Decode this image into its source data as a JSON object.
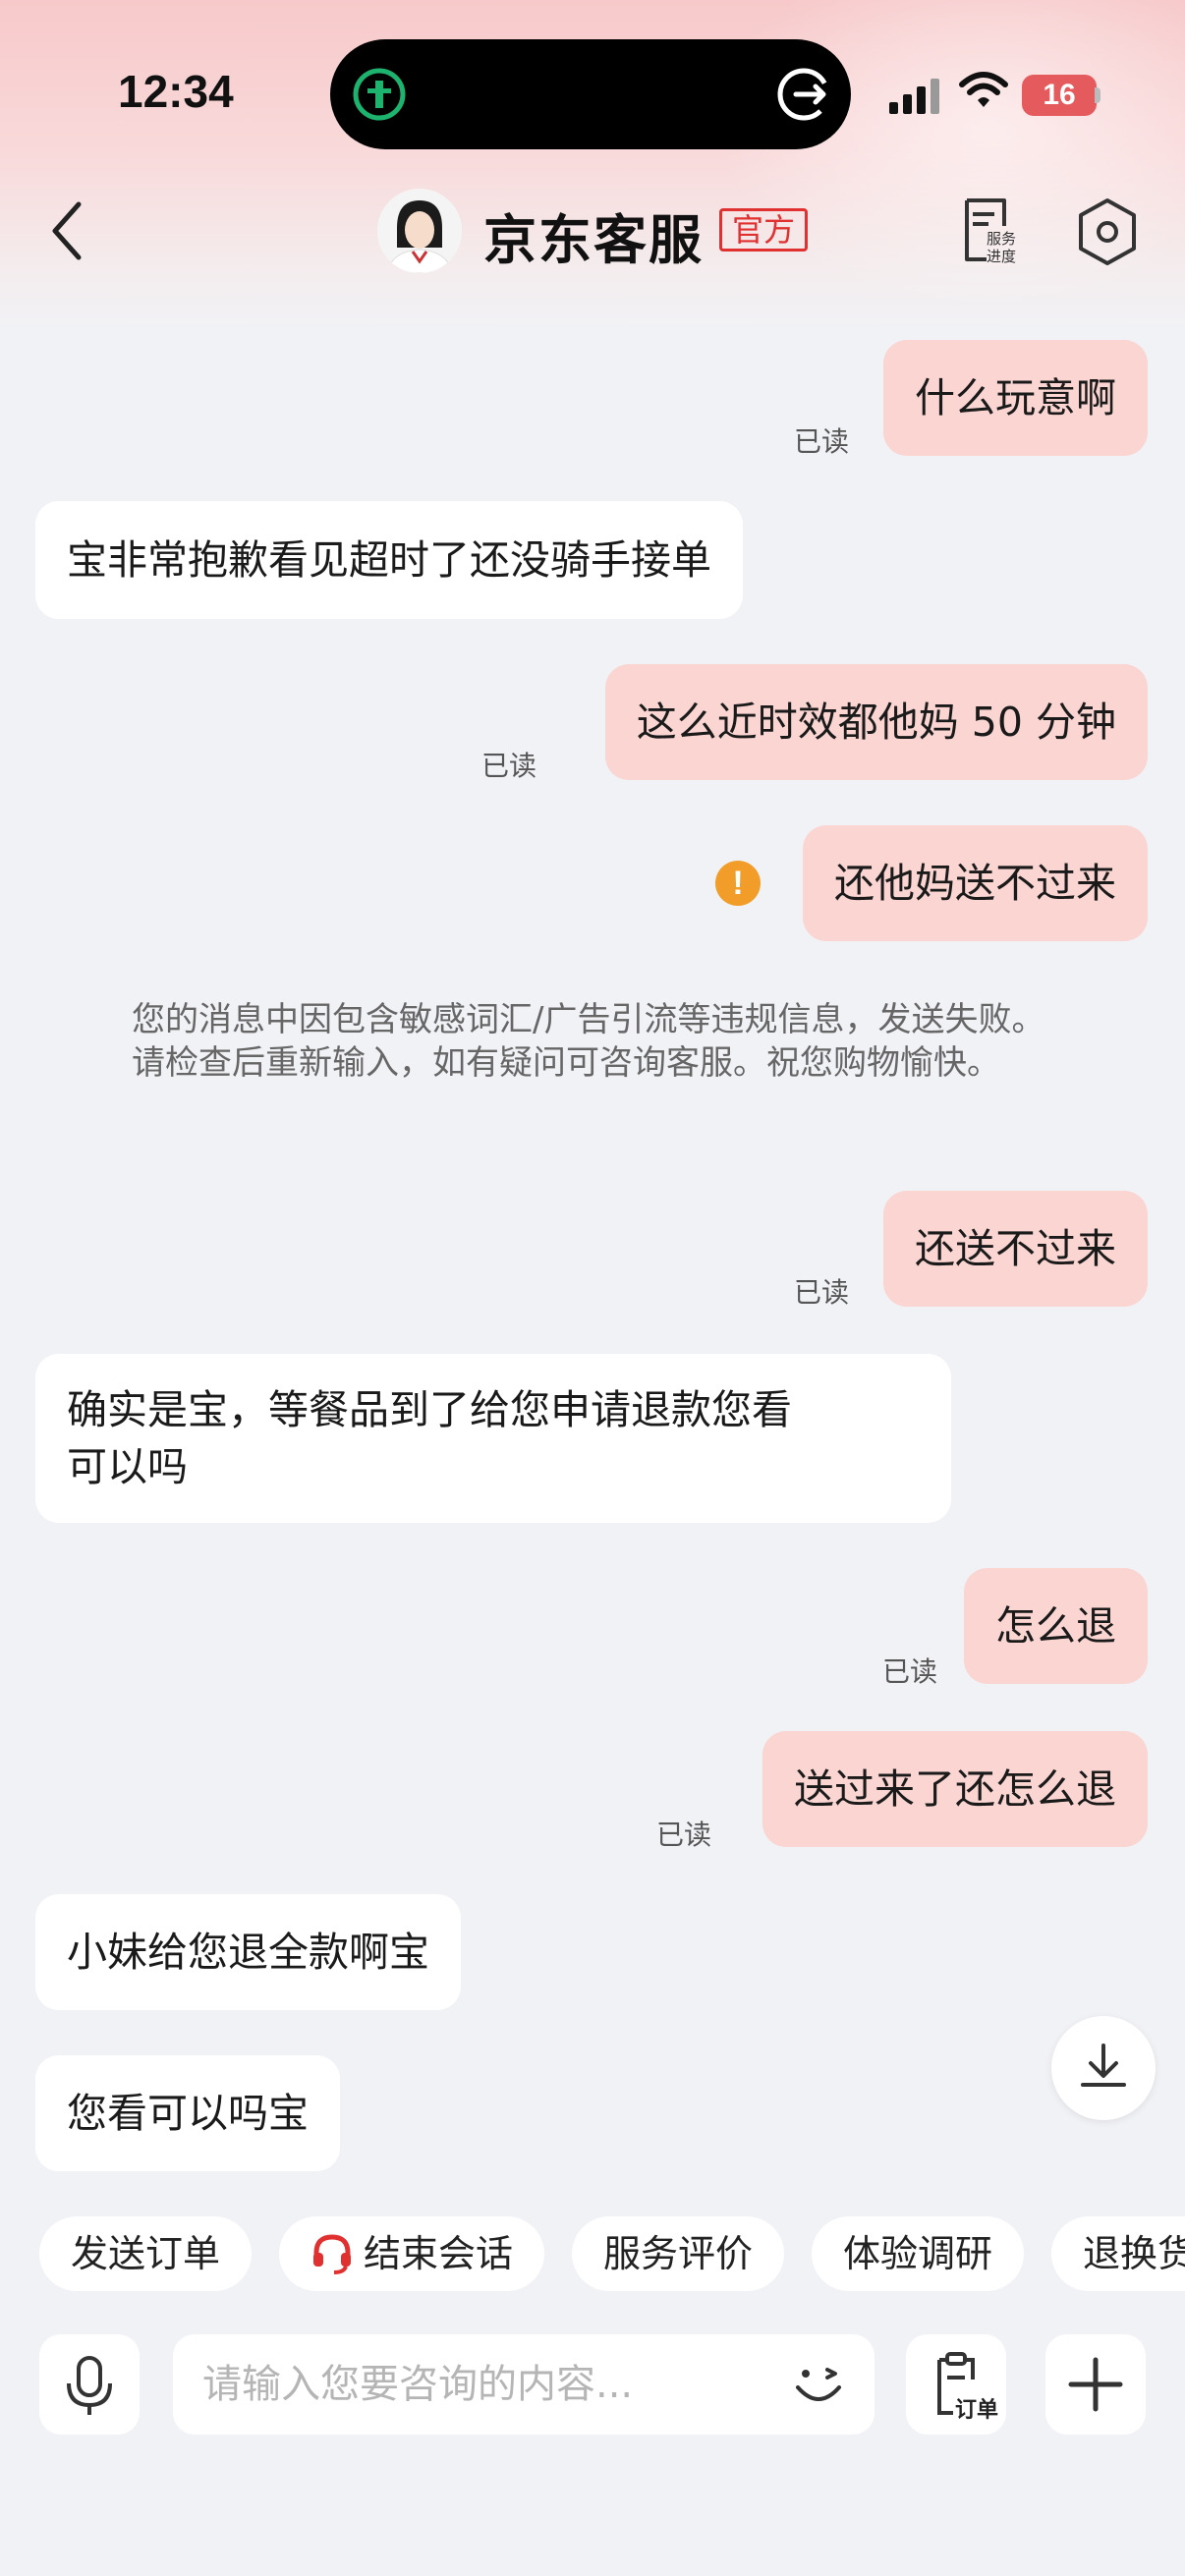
{
  "status_bar": {
    "time": "12:34",
    "battery": "16"
  },
  "header": {
    "title": "京东客服",
    "badge": "官方",
    "service_icon_label_line1": "服务",
    "service_icon_label_line2": "进度"
  },
  "messages": [
    {
      "dir": "out",
      "text": "什么玩意啊",
      "status": "已读"
    },
    {
      "dir": "in",
      "text": "宝非常抱歉看见超时了还没骑手接单"
    },
    {
      "dir": "out",
      "text": "这么近时效都他妈 50 分钟",
      "status": "已读"
    },
    {
      "dir": "out",
      "text": "还他妈送不过来",
      "failed": true
    },
    {
      "dir": "system",
      "text": "您的消息中因包含敏感词汇/广告引流等违规信息，发送失败。请检查后重新输入，如有疑问可咨询客服。祝您购物愉快。"
    },
    {
      "dir": "out",
      "text": "还送不过来",
      "status": "已读"
    },
    {
      "dir": "in",
      "text_line1": "确实是宝，等餐品到了给您申请退款您看",
      "text_line2": "可以吗"
    },
    {
      "dir": "out",
      "text": "怎么退",
      "status": "已读"
    },
    {
      "dir": "out",
      "text": "送过来了还怎么退",
      "status": "已读"
    },
    {
      "dir": "in",
      "text": "小妹给您退全款啊宝"
    },
    {
      "dir": "in",
      "text": "您看可以吗宝"
    }
  ],
  "quick_actions": [
    "发送订单",
    "结束会话",
    "服务评价",
    "体验调研",
    "退换货"
  ],
  "input": {
    "placeholder": "请输入您要咨询的内容...",
    "value": "",
    "order_label": "订单"
  },
  "colors": {
    "outgoing_bubble": "#fad5d2",
    "incoming_bubble": "#ffffff",
    "accent_red": "#e0302f",
    "warning": "#f29d2a",
    "background": "#f1f2f6"
  }
}
